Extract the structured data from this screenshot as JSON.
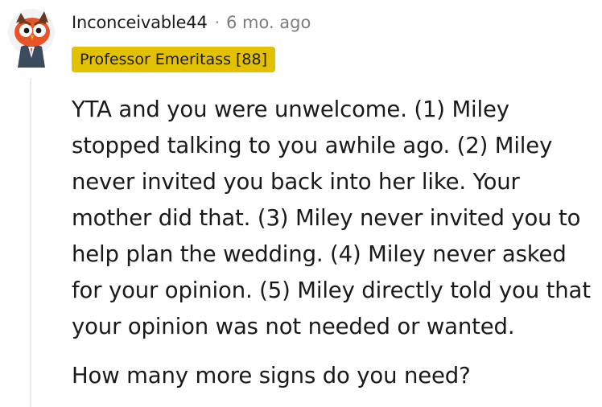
{
  "comment": {
    "username": "Inconceivable44",
    "separator": "·",
    "timestamp": "6 mo. ago",
    "flair": "Professor Emeritass [88]",
    "flair_color": "#e3c000",
    "avatar_icon": "owl-avatar-icon",
    "paragraphs": [
      "YTA and you were unwelcome. (1) Miley stopped talking to you awhile ago. (2) Miley never invited you back into her like. Your mother did that. (3) Miley never invited you to help plan the wedding. (4) Miley never asked for your opinion. (5) Miley directly told you that your opinion was not needed or wanted.",
      "How many more signs do you need?"
    ]
  }
}
